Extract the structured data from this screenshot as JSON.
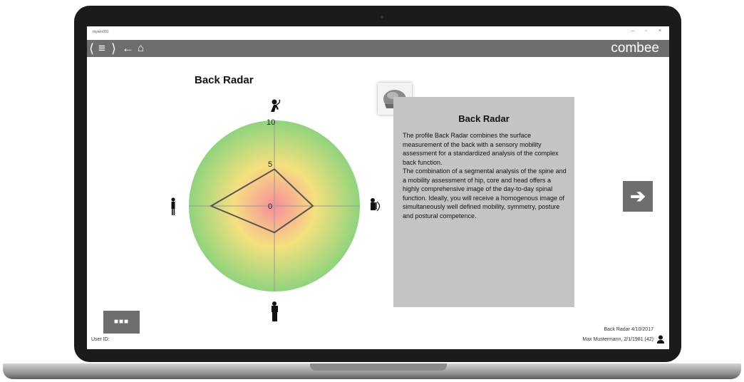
{
  "window": {
    "title": "mywin001",
    "controls": [
      "–",
      "▫",
      "×"
    ]
  },
  "header": {
    "menu_icon": "hamburger-icon",
    "back_icon": "arrow-left-icon",
    "home_icon": "home-icon",
    "brand": "combee"
  },
  "page": {
    "title": "Back Radar"
  },
  "radar": {
    "scale_labels": [
      "10",
      "5",
      "0"
    ],
    "axes": [
      "top: head/neck figure",
      "right: torso figure",
      "bottom: hip figure",
      "left: standing figure"
    ],
    "profile_values": {
      "top": 4.3,
      "right": 4.5,
      "bottom": 3.1,
      "left": 7.4
    },
    "max": 10,
    "colors": {
      "center": "#f78d9a",
      "middle": "#f5e07f",
      "outer": "#8fd47c",
      "line": "#555555"
    }
  },
  "info": {
    "icon": "back-measurement-icon",
    "title": "Back Radar",
    "paragraph1": "The profile Back Radar combines the surface measurement of the back with a sensory mobility assessment for a standardized analysis of the complex back function.",
    "paragraph2": "The combination of a segmental analysis of the spine and a mobility assessment of hip, core and head offers a highly comprehensive image of the day-to-day spinal function. Ideally, you will receive a homogenous image of simultaneously well defined mobility, symmetry, posture and postural competence."
  },
  "controls": {
    "next_icon": "arrow-right-icon",
    "more_label": "■■■"
  },
  "footer": {
    "user_id_label": "User ID:",
    "report": "Back Radar 4/10/2017",
    "patient": "Max Mustermann, 2/1/1981 (42)",
    "user_icon": "person-icon"
  }
}
